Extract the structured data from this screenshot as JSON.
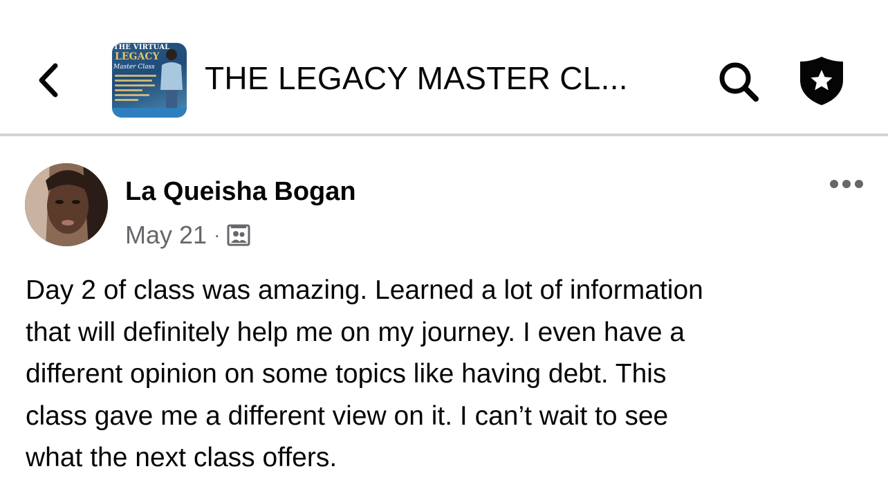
{
  "header": {
    "back_icon": "chevron-left-icon",
    "group_title": "THE LEGACY MASTER CL...",
    "thumbnail": {
      "line1": "THE VIRTUAL",
      "line2": "LEGACY",
      "line3": "Master Class"
    },
    "search_icon": "search-icon",
    "admin_icon": "shield-star-icon"
  },
  "post": {
    "author": "La Queisha Bogan",
    "date": "May 21",
    "separator": "·",
    "audience_icon": "group-members-icon",
    "more_icon": "more-horizontal-icon",
    "body_lines": [
      "Day 2 of class was amazing. Learned a lot of information",
      "that will definitely help me on my journey. I even have a",
      "different opinion on some topics like having debt. This",
      "class gave me a different view on it. I can’t wait to see",
      "what the next class offers."
    ]
  },
  "colors": {
    "text_primary": "#050505",
    "text_secondary": "#65676b",
    "divider": "#d4d4d6",
    "background": "#ffffff"
  }
}
